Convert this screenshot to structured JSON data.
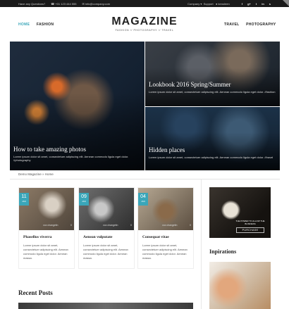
{
  "topbar": {
    "question": "Have any Questions?",
    "phone": "+01 123 444 555",
    "email": "info@company.com",
    "company": "Company",
    "support": "Support",
    "user": "kenoleen",
    "social": [
      "f",
      "g+",
      "t",
      "in",
      "s"
    ]
  },
  "header": {
    "nav_left": [
      "HOME",
      "FASHION"
    ],
    "nav_right": [
      "TRAVEL",
      "PHOTOGRAPHY"
    ],
    "logo": "MAGAZINE",
    "tagline": "FASHION // PHOTOGRAPHY // TRAVEL"
  },
  "hero": [
    {
      "title": "How to take amazing photos",
      "excerpt": "Lorem ipsum dolor sit amet, consectetuer adipiscing elit. Aenean commodo ligula eget dolor. //photography"
    },
    {
      "title": "Lookbook 2016 Spring/Summer",
      "excerpt": "Lorem ipsum dolor sit amet, consectetuer adipiscing elit. Aenean commodo ligula eget dolor. //fashion"
    },
    {
      "title": "Hidden places",
      "excerpt": "Lorem ipsum dolor sit amet, consectetuer adipiscing elit. Aenean commodo ligula eget dolor. //travel"
    }
  ],
  "breadcrumb": "Demo Magazine  »  Home",
  "cards": [
    {
      "day": "11",
      "month": "JAN",
      "author": "vox changelin",
      "comments": "0",
      "title": "Phasellus viverra",
      "excerpt": "Lorem ipsum dolor sit amet, consectetuer adipiscing elit. Aenean commodo ligula eget dolor. Aenean massa."
    },
    {
      "day": "09",
      "month": "JAN",
      "author": "vox changelin",
      "comments": "0",
      "title": "Aenean vulputate",
      "excerpt": "Lorem ipsum dolor sit amet, consectetuer adipiscing elit. Aenean commodo ligula eget dolor. Aenean massa."
    },
    {
      "day": "04",
      "month": "JAN",
      "author": "vox changelin",
      "comments": "0",
      "title": "Consequat vitae",
      "excerpt": "Lorem ipsum dolor sit amet, consectetuer adipiscing elit. Aenean commodo ligula eget dolor. Aenean massa."
    }
  ],
  "recent_posts": "Recent Posts",
  "sidebar": {
    "ad_text": "THE POWER TO ALLOW THE BUSINESS",
    "ad_button": "PURCHASE",
    "inspirations": "Inpirations"
  },
  "colors": {
    "accent": "#3aa6b9"
  }
}
